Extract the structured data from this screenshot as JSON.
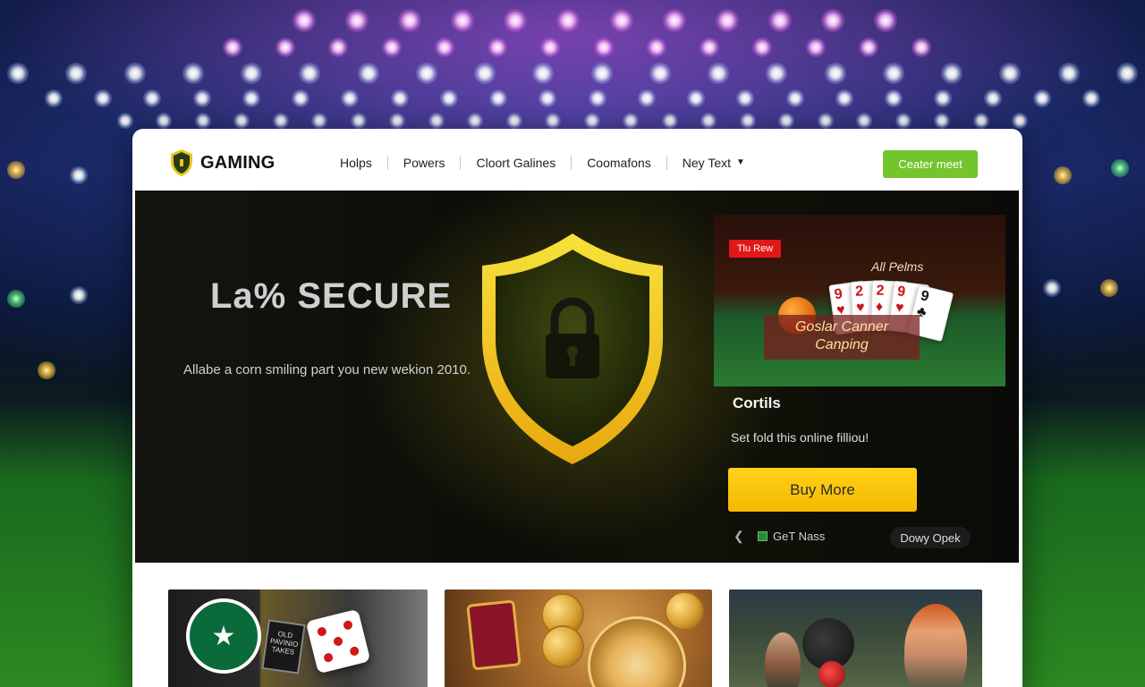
{
  "brand": {
    "name": "GAMING"
  },
  "nav": {
    "items": [
      "Holps",
      "Powers",
      "Cloort Galines",
      "Coomafons",
      "Ney Text"
    ],
    "cta_label": "Ceater meet"
  },
  "hero": {
    "title": "La% SECURE",
    "subtitle": "Allabe a corn smiling part you new wekion 2010.",
    "shield_icon": "shield-lock-icon"
  },
  "side_panel": {
    "image": {
      "badge": "Tlu Rew",
      "caption": "All Pelms",
      "title_line1": "Goslar Canner",
      "title_line2": "Canping"
    },
    "heading": "Cortils",
    "text": "Set fold this online filliou!",
    "buy_label": "Buy More",
    "get_news_label": "GeT Nass",
    "day_open_label": "Dowy Opek"
  },
  "thumbnails": {
    "thumb1_pack_text": "OLD PAVINIO TAKES"
  },
  "colors": {
    "cta_green": "#74c42c",
    "buy_yellow": "#ffd21a",
    "shield_yellow": "#f2d21a",
    "badge_red": "#e01818"
  }
}
